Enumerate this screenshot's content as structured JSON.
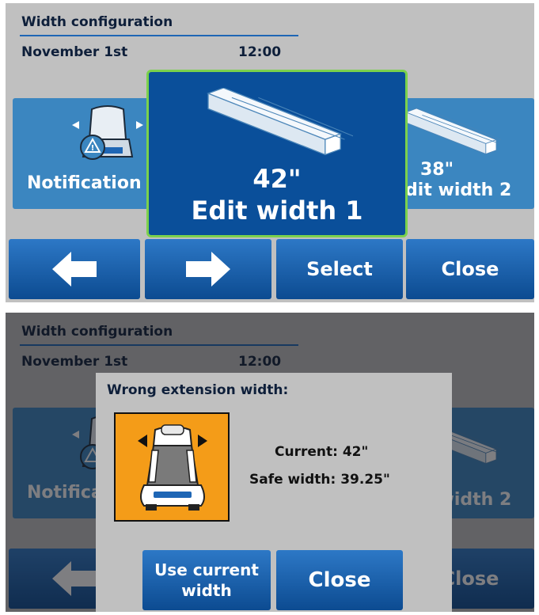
{
  "header": {
    "title": "Width configuration",
    "date": "November 1st",
    "time": "12:00"
  },
  "tiles": {
    "left": {
      "label": "Notification",
      "icon": "bed-notification-icon"
    },
    "center": {
      "value": "42\"",
      "label": "Edit width 1",
      "icon": "width-extension-icon"
    },
    "right": {
      "value": "38\"",
      "label": "Edit width 2",
      "icon": "width-extension-icon"
    }
  },
  "buttons": {
    "prev": "◀",
    "next": "▶",
    "select": "Select",
    "close": "Close"
  },
  "dialog": {
    "title": "Wrong extension width:",
    "current": "Current: 42\"",
    "safe_width": "Safe width: 39.25\"",
    "use_current_line1": "Use current",
    "use_current_line2": "width",
    "close": "Close"
  },
  "colors": {
    "background": "#c0c0c0",
    "tile": "#3b86c0",
    "tile_selected": "#0a4f9a",
    "selection_border": "#7bd14c",
    "button_top": "#2d78c6",
    "button_bottom": "#0c4b91",
    "warning": "#f49c18"
  }
}
